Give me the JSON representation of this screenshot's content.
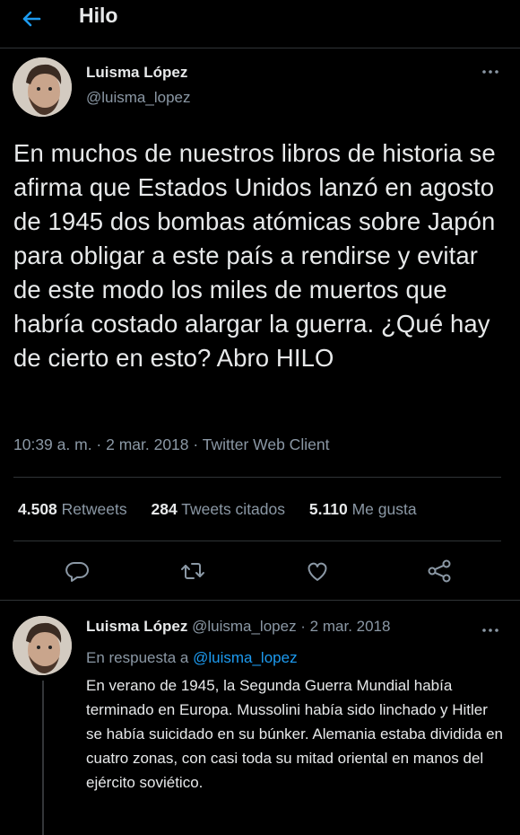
{
  "header": {
    "title": "Hilo"
  },
  "main_tweet": {
    "author_name": "Luisma López",
    "handle": "@luisma_lopez",
    "text": "En muchos de nuestros libros de historia se afirma que Estados Unidos lanzó en agosto de 1945 dos bombas atómicas sobre Japón para obligar a este país a rendirse y evitar de este modo los miles de muertos que habría costado alargar la guerra. ¿Qué hay de cierto en esto? Abro HILO",
    "meta": "10:39 a. m. · 2 mar. 2018 · Twitter Web Client",
    "stats": {
      "retweets_count": "4.508",
      "retweets_label": "Retweets",
      "quotes_count": "284",
      "quotes_label": "Tweets citados",
      "likes_count": "5.110",
      "likes_label": "Me gusta"
    }
  },
  "reply_tweet": {
    "author_name": "Luisma López",
    "handle_date": "@luisma_lopez · 2 mar. 2018",
    "reply_prefix": "En respuesta a",
    "reply_to": "@luisma_lopez",
    "text": "En verano de 1945, la Segunda Guerra Mundial había terminado en Europa. Mussolini había sido linchado y Hitler se había suicidado en su búnker. Alemania estaba dividida en cuatro zonas, con casi toda su mitad oriental en manos del ejército soviético."
  },
  "colors": {
    "accent": "#1d9bf0",
    "secondary_text": "#8b98a5",
    "background": "#000000"
  },
  "icons": [
    "back-arrow-icon",
    "more-icon",
    "reply-icon",
    "retweet-icon",
    "like-icon",
    "share-icon"
  ]
}
